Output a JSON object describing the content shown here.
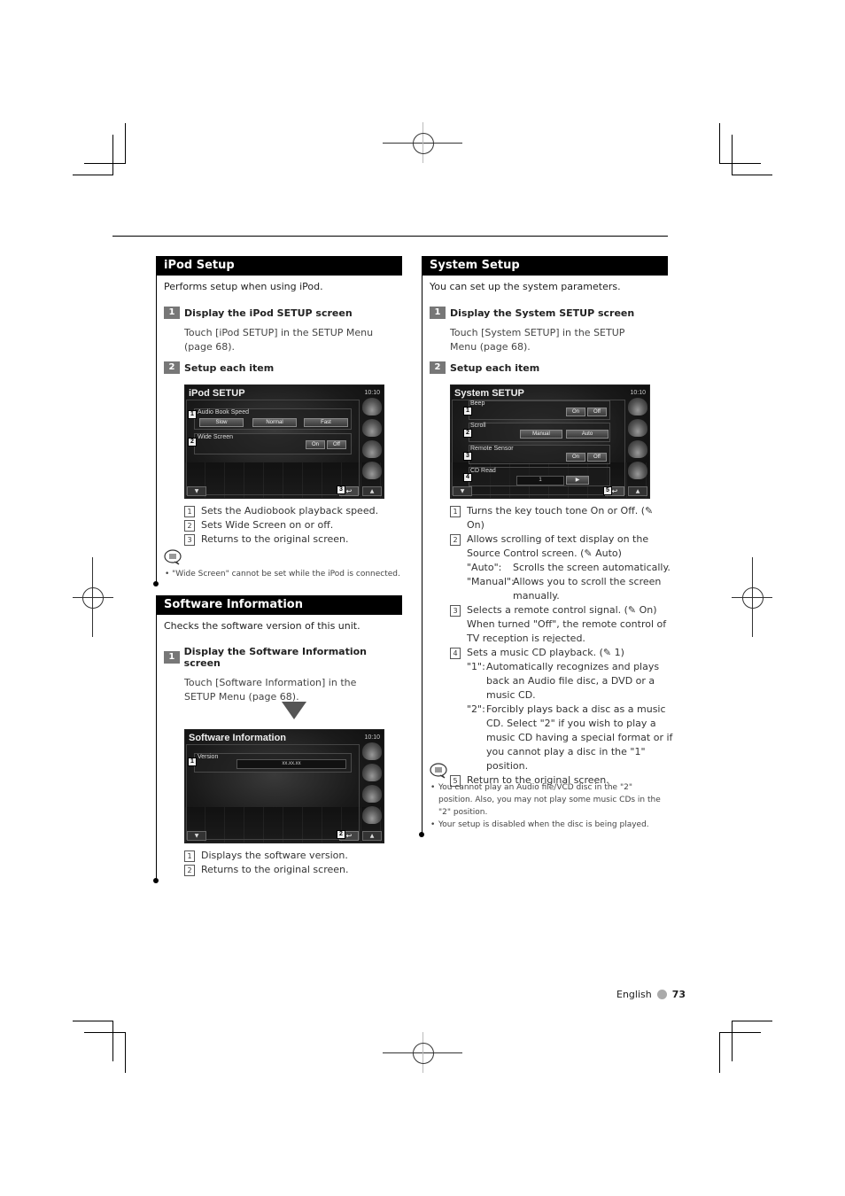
{
  "ipod": {
    "title": "iPod Setup",
    "intro": "Performs setup when using iPod.",
    "step1": {
      "num": "1",
      "label": "Display the iPod SETUP screen",
      "desc": "Touch [iPod SETUP] in the SETUP Menu (page 68)."
    },
    "step2": {
      "num": "2",
      "label": "Setup each item"
    },
    "screen": {
      "title": "iPod SETUP",
      "time": "10:10",
      "audiobook_label": "Audio Book Speed",
      "speed_options": [
        "Slow",
        "Normal",
        "Fast"
      ],
      "wide_label": "Wide Screen",
      "on": "On",
      "off": "Off",
      "callouts": [
        "1",
        "2",
        "3"
      ]
    },
    "items": [
      {
        "num": "1",
        "text": "Sets the Audiobook playback speed."
      },
      {
        "num": "2",
        "text": "Sets Wide Screen on or off."
      },
      {
        "num": "3",
        "text": "Returns to the original screen."
      }
    ],
    "notes": [
      "\"Wide Screen\" cannot be set while the iPod is connected."
    ]
  },
  "software": {
    "title": "Software Information",
    "intro": "Checks the software version of this unit.",
    "step1": {
      "num": "1",
      "label": "Display the Software Information screen",
      "desc": "Touch [Software Information] in the SETUP Menu (page 68)."
    },
    "screen": {
      "title": "Software Information",
      "time": "10:10",
      "version_label": "Version",
      "version_value": "xx.xx.xx",
      "callouts": [
        "1",
        "2"
      ]
    },
    "items": [
      {
        "num": "1",
        "text": "Displays the software version."
      },
      {
        "num": "2",
        "text": "Returns to the original screen."
      }
    ]
  },
  "system": {
    "title": "System Setup",
    "intro": "You can set up the system parameters.",
    "step1": {
      "num": "1",
      "label": "Display the System SETUP screen",
      "desc": "Touch [System SETUP] in the SETUP Menu (page 68)."
    },
    "step2": {
      "num": "2",
      "label": "Setup each item"
    },
    "screen": {
      "title": "System SETUP",
      "time": "10:10",
      "beep_label": "Beep",
      "scroll_label": "Scroll",
      "scroll_options": [
        "Manual",
        "Auto"
      ],
      "remote_label": "Remote Sensor",
      "cdread_label": "CD Read",
      "cdread_value": "1",
      "on": "On",
      "off": "Off",
      "callouts": [
        "1",
        "2",
        "3",
        "4",
        "5"
      ]
    },
    "items": [
      {
        "num": "1",
        "text": "Turns the key touch tone On or Off. (✎ On)"
      },
      {
        "num": "2",
        "text": "Allows scrolling of text display on the Source Control screen. (✎ Auto)"
      },
      {
        "num": "3",
        "text": "Selects a remote control signal. (✎ On) When turned \"Off\", the remote control of TV reception is rejected."
      },
      {
        "num": "4",
        "text": "Sets a music CD playback. (✎ 1)"
      },
      {
        "num": "5",
        "text": "Return to the original screen."
      }
    ],
    "scroll_sub": [
      {
        "key": "\"Auto\":",
        "text": "Scrolls the screen automatically."
      },
      {
        "key": "\"Manual\":",
        "text": "Allows you to scroll the screen manually."
      }
    ],
    "cd_sub": [
      {
        "key": "\"1\":",
        "text": "Automatically recognizes and plays back an Audio file disc, a DVD or a music CD."
      },
      {
        "key": "\"2\":",
        "text": "Forcibly plays back a disc as a music CD. Select \"2\" if you wish to play a music CD having a special format or if you cannot play a disc in the \"1\" position."
      }
    ],
    "notes": [
      "You cannot play an Audio file/VCD disc in the \"2\" position. Also, you may not play some music CDs in the \"2\" position.",
      "Your setup is disabled when the disc is being played."
    ]
  },
  "footer": {
    "language": "English",
    "page": "73"
  }
}
